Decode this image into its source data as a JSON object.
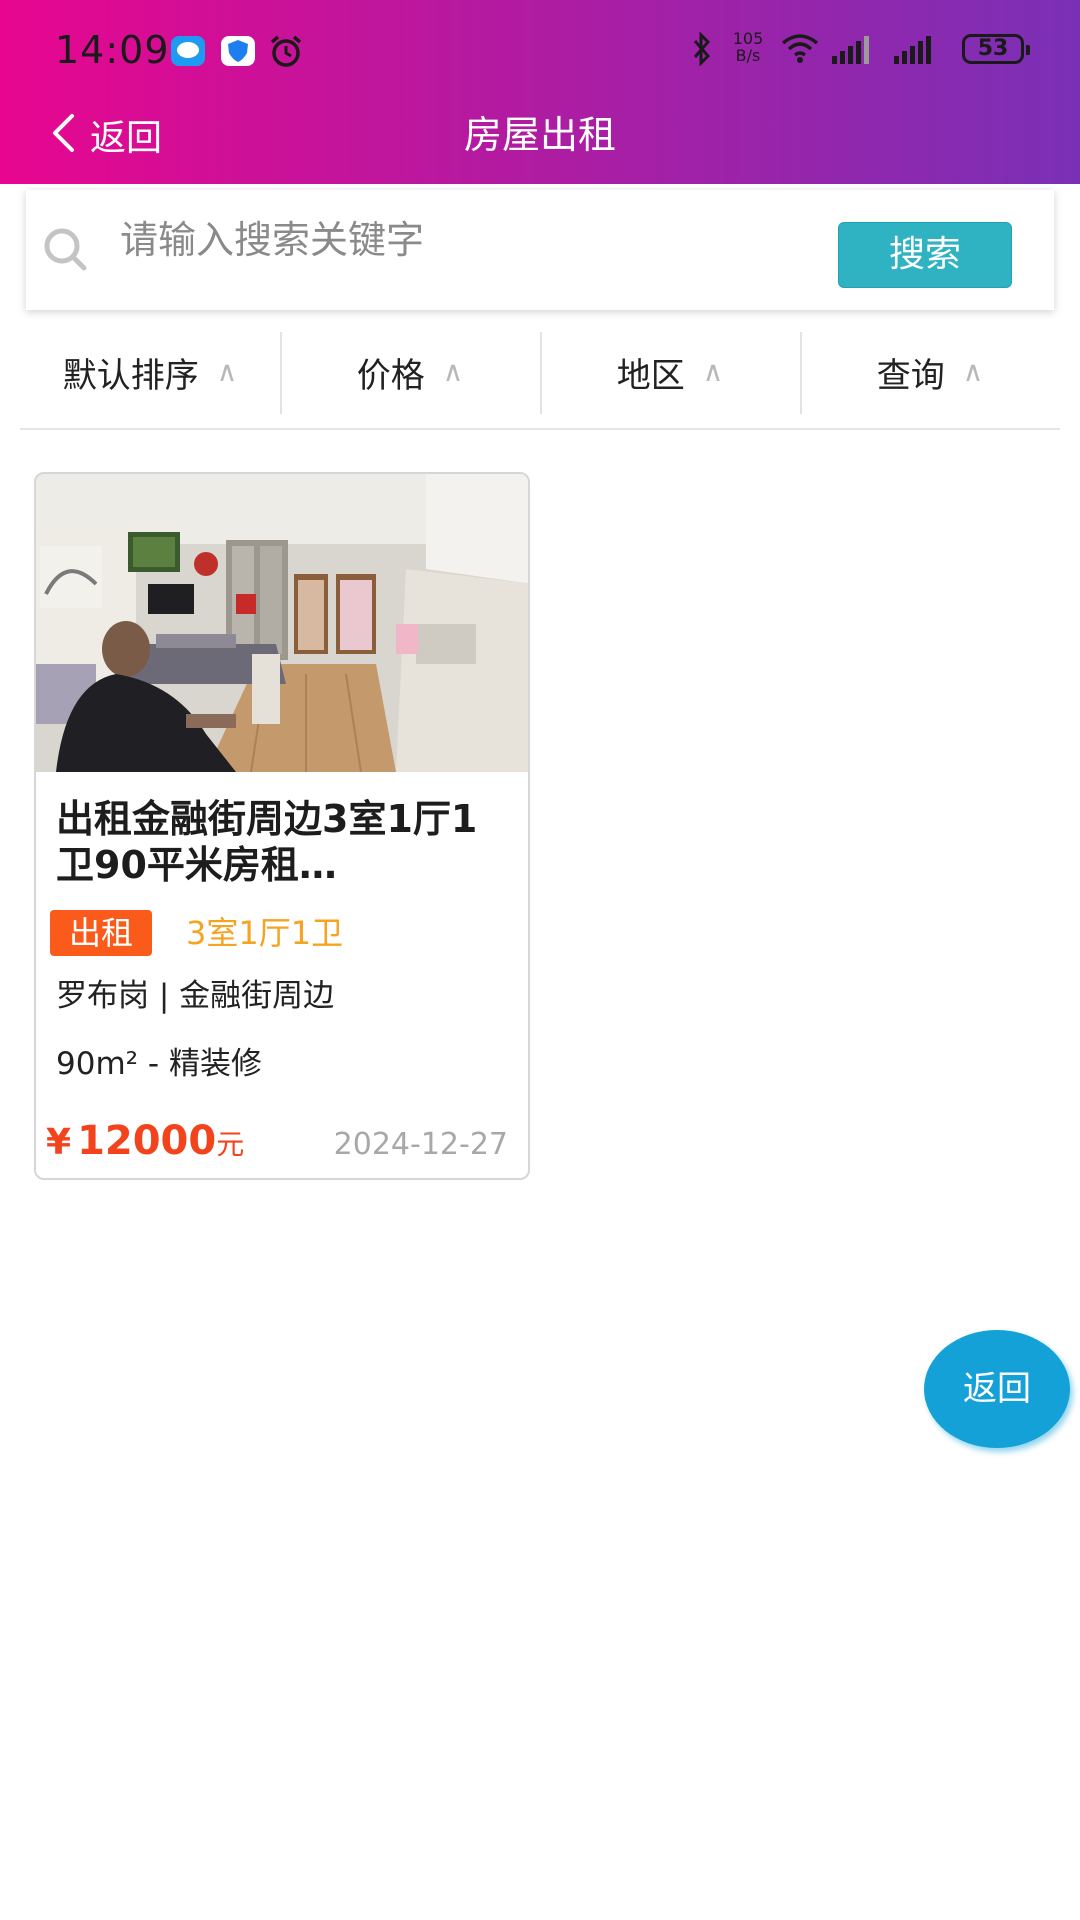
{
  "status_bar": {
    "time": "14:09",
    "network_speed_value": "105",
    "network_speed_unit": "B/s",
    "battery": "53"
  },
  "nav": {
    "back_label": "返回",
    "title": "房屋出租"
  },
  "search": {
    "placeholder": "请输入搜索关键字",
    "value": "",
    "button_label": "搜索"
  },
  "filters": [
    {
      "label": "默认排序",
      "caret": "∧"
    },
    {
      "label": "价格",
      "caret": "∧"
    },
    {
      "label": "地区",
      "caret": "∧"
    },
    {
      "label": "查询",
      "caret": "∧"
    }
  ],
  "listing": {
    "title": "出租金融街周边3室1厅1卫90平米房租…",
    "tag": "出租",
    "rooms": "3室1厅1卫",
    "location": "罗布岗 | 金融街周边",
    "area": "90m² - 精装修",
    "price_symbol": "¥",
    "price": "12000",
    "price_unit": "元",
    "date": "2024-12-27"
  },
  "fab": {
    "label": "返回"
  },
  "colors": {
    "header_gradient_start": "#e8068f",
    "header_gradient_end": "#7a30b6",
    "search_button": "#2fb3c2",
    "tag_bg": "#fa5a1a",
    "rooms_text": "#f5a422",
    "price_text": "#f2431c",
    "fab_bg": "#13a1d8"
  },
  "icons": {
    "back": "chevron-left-icon",
    "search": "magnifier-icon",
    "status": [
      "message-icon",
      "shield-icon",
      "alarm-icon",
      "bluetooth-icon",
      "wifi-icon",
      "signal-icon",
      "battery-icon"
    ]
  }
}
